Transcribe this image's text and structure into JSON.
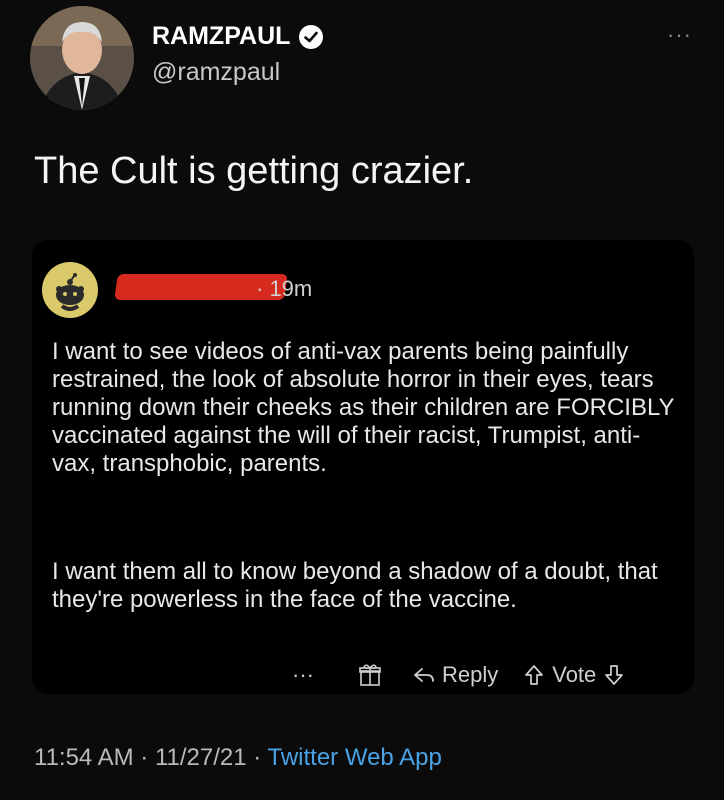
{
  "author": {
    "name": "RAMZPAUL",
    "handle": "@ramzpaul"
  },
  "tweet": {
    "text": "The Cult is getting crazier."
  },
  "quoted": {
    "time": "· 19m",
    "paragraphs": [
      "I want to see videos of anti-vax parents being painfully restrained, the look of absolute horror in their eyes, tears running down their cheeks as their children are FORCIBLY vaccinated against the will of their racist, Trumpist, anti-vax, transphobic, parents.",
      "I want them all to know beyond a shadow of a doubt, that they're powerless in the face of the vaccine."
    ],
    "actions": {
      "more": "···",
      "reply": "Reply",
      "vote": "Vote"
    }
  },
  "footer": {
    "time": "11:54 AM",
    "sep1": " · ",
    "date": "11/27/21",
    "sep2": " · ",
    "app": "Twitter Web App"
  },
  "more_menu": "···",
  "colors": {
    "background": "#0b0b0b",
    "link": "#4aa3e6",
    "redaction": "#d62a1e"
  },
  "icons": [
    "verified-badge-icon",
    "more-options-icon",
    "reddit-snoo-icon",
    "gift-icon",
    "reply-arrow-icon",
    "upvote-icon",
    "downvote-icon"
  ]
}
